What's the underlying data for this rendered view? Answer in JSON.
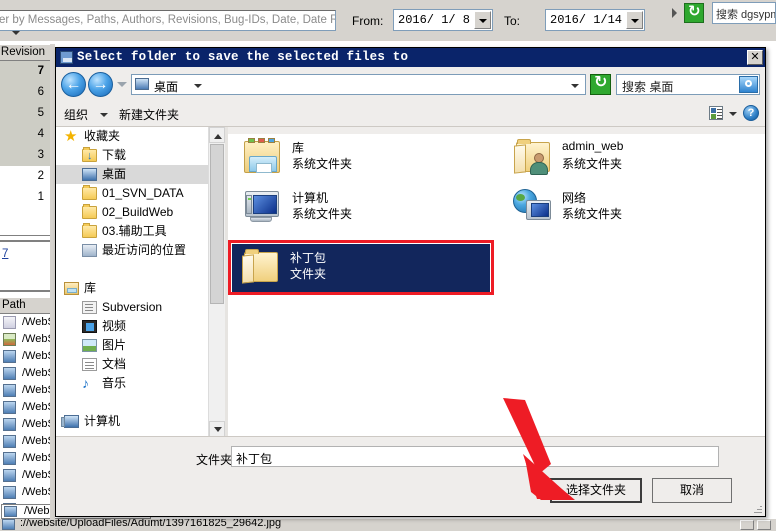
{
  "background_app": {
    "filter_placeholder": "er by Messages, Paths, Authors, Revisions, Bug-IDs, Date, Date Ran",
    "from_label": "From:",
    "from_value": "2016/ 1/ 8",
    "to_label": "To:",
    "to_value": "2016/ 1/14",
    "top_search_value": "搜索 dgsypm",
    "revision_header": "Revision",
    "revisions": [
      "7",
      "6",
      "5",
      "4",
      "3",
      "2",
      "1"
    ],
    "message_link": "7",
    "path_header": "Path",
    "paths": [
      "/WebSi",
      "/WebSi",
      "/WebSi",
      "/WebSi",
      "/WebSi",
      "/WebSi",
      "/WebSi",
      "/WebSi",
      "/WebSi",
      "/WebSi",
      "/WebSi",
      "/WebSi"
    ],
    "floating_path": "/WebSi",
    "status_path": "://website/UploadFiles/Adumt/1397161825_29642.jpg"
  },
  "dialog": {
    "title": "Select folder to save the selected files to",
    "close_label": "✕",
    "address": {
      "back_glyph": "←",
      "forward_glyph": "→",
      "crumb": "桌面",
      "search_value": "搜索 桌面"
    },
    "toolbar": {
      "organize_label": "组织",
      "new_folder_label": "新建文件夹",
      "help_glyph": "?"
    },
    "tree": [
      {
        "label": "收藏夹",
        "icon": "star-icon",
        "level": 0,
        "selected": false
      },
      {
        "label": "下载",
        "icon": "download-folder-icon",
        "level": 1,
        "selected": false
      },
      {
        "label": "桌面",
        "icon": "desktop-icon",
        "level": 1,
        "selected": true
      },
      {
        "label": "01_SVN_DATA",
        "icon": "folder-icon",
        "level": 1,
        "selected": false
      },
      {
        "label": "02_BuildWeb",
        "icon": "folder-icon",
        "level": 1,
        "selected": false
      },
      {
        "label": "03.辅助工具",
        "icon": "folder-icon",
        "level": 1,
        "selected": false
      },
      {
        "label": "最近访问的位置",
        "icon": "recent-places-icon",
        "level": 1,
        "selected": false
      },
      {
        "label": "",
        "icon": "spacer",
        "level": 0,
        "selected": false
      },
      {
        "label": "库",
        "icon": "library-icon",
        "level": 0,
        "selected": false
      },
      {
        "label": "Subversion",
        "icon": "subversion-icon",
        "level": 1,
        "selected": false
      },
      {
        "label": "视频",
        "icon": "video-icon",
        "level": 1,
        "selected": false
      },
      {
        "label": "图片",
        "icon": "pictures-icon",
        "level": 1,
        "selected": false
      },
      {
        "label": "文档",
        "icon": "documents-icon",
        "level": 1,
        "selected": false
      },
      {
        "label": "音乐",
        "icon": "music-icon",
        "level": 1,
        "selected": false
      },
      {
        "label": "",
        "icon": "spacer",
        "level": 0,
        "selected": false
      },
      {
        "label": "计算机",
        "icon": "computer-icon",
        "level": 0,
        "selected": false
      }
    ],
    "files": [
      {
        "name": "库",
        "type": "系统文件夹",
        "icon": "library-big-icon",
        "selected": false
      },
      {
        "name": "admin_web",
        "type": "系统文件夹",
        "icon": "user-folder-big-icon",
        "selected": false
      },
      {
        "name": "计算机",
        "type": "系统文件夹",
        "icon": "computer-big-icon",
        "selected": false
      },
      {
        "name": "网络",
        "type": "系统文件夹",
        "icon": "network-big-icon",
        "selected": false
      },
      {
        "name": "补丁包",
        "type": "文件夹",
        "icon": "folder-big-icon",
        "selected": true
      }
    ],
    "footer": {
      "folder_label": "文件夹:",
      "folder_value": "补丁包",
      "choose_label": "选择文件夹",
      "cancel_label": "取消"
    }
  },
  "colors": {
    "title_bar": "#0a246a",
    "selection": "#12265c",
    "annotation_red": "#ee1c25",
    "dialog_face": "#efedeb",
    "app_face": "#d6d3ce"
  }
}
